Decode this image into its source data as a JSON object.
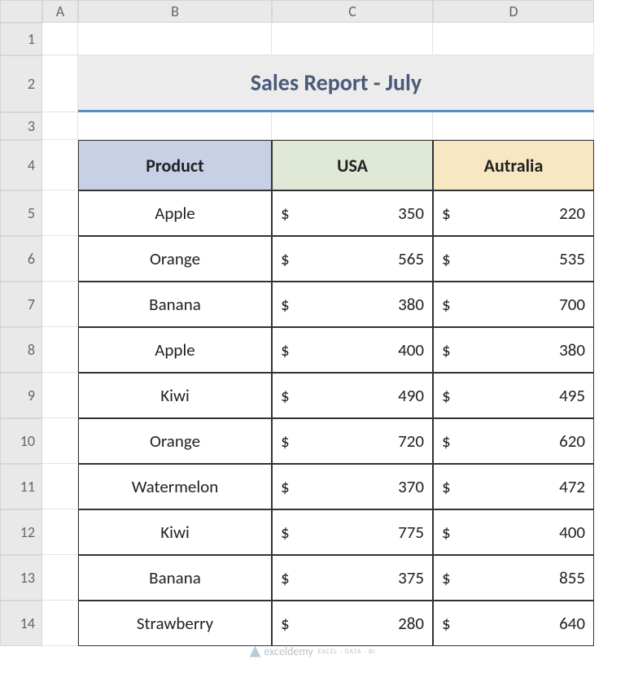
{
  "columns": [
    "A",
    "B",
    "C",
    "D"
  ],
  "rows": [
    "1",
    "2",
    "3",
    "4",
    "5",
    "6",
    "7",
    "8",
    "9",
    "10",
    "11",
    "12",
    "13",
    "14"
  ],
  "title": "Sales Report - July",
  "headers": {
    "product": "Product",
    "usa": "USA",
    "australia": "Autralia"
  },
  "currency": "$",
  "data": [
    {
      "product": "Apple",
      "usa": "350",
      "aus": "220"
    },
    {
      "product": "Orange",
      "usa": "565",
      "aus": "535"
    },
    {
      "product": "Banana",
      "usa": "380",
      "aus": "700"
    },
    {
      "product": "Apple",
      "usa": "400",
      "aus": "380"
    },
    {
      "product": "Kiwi",
      "usa": "490",
      "aus": "495"
    },
    {
      "product": "Orange",
      "usa": "720",
      "aus": "620"
    },
    {
      "product": "Watermelon",
      "usa": "370",
      "aus": "472"
    },
    {
      "product": "Kiwi",
      "usa": "775",
      "aus": "400"
    },
    {
      "product": "Banana",
      "usa": "375",
      "aus": "855"
    },
    {
      "product": "Strawberry",
      "usa": "280",
      "aus": "640"
    }
  ],
  "watermark": {
    "brand": "exceldemy",
    "sub": "EXCEL · DATA · BI"
  }
}
